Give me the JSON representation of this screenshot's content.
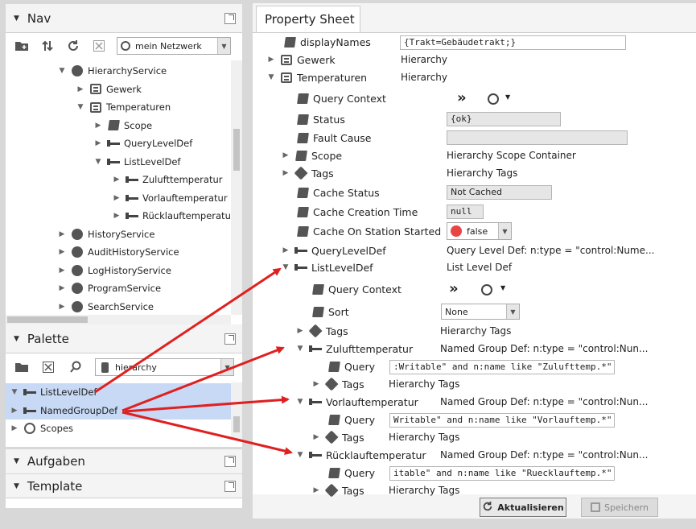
{
  "nav": {
    "title": "Nav",
    "network_label": "mein Netzwerk",
    "tree": [
      {
        "label": "HierarchyService",
        "icon": "hierarchy-service-icon",
        "toggle": "▼"
      },
      {
        "label": "Gewerk",
        "icon": "hierarchy-icon",
        "toggle": "▶"
      },
      {
        "label": "Temperaturen",
        "icon": "hierarchy-icon",
        "toggle": "▼"
      },
      {
        "label": "Scope",
        "icon": "scope-icon",
        "toggle": "▶"
      },
      {
        "label": "QueryLevelDef",
        "icon": "level-def-icon",
        "toggle": "▶"
      },
      {
        "label": "ListLevelDef",
        "icon": "level-def-icon",
        "toggle": "▼"
      },
      {
        "label": "Zulufttemperatur",
        "icon": "level-def-icon",
        "toggle": "▶"
      },
      {
        "label": "Vorlauftemperatur",
        "icon": "level-def-icon",
        "toggle": "▶"
      },
      {
        "label": "Rücklauftemperatur",
        "icon": "level-def-icon",
        "toggle": "▶"
      },
      {
        "label": "HistoryService",
        "icon": "history-service-icon",
        "toggle": "▶"
      },
      {
        "label": "AuditHistoryService",
        "icon": "audit-history-icon",
        "toggle": "▶"
      },
      {
        "label": "LogHistoryService",
        "icon": "log-history-icon",
        "toggle": "▶"
      },
      {
        "label": "ProgramService",
        "icon": "program-service-icon",
        "toggle": "▶"
      },
      {
        "label": "SearchService",
        "icon": "search-service-icon",
        "toggle": "▶"
      }
    ]
  },
  "palette": {
    "title": "Palette",
    "search_value": "hierarchy",
    "items": [
      {
        "label": "ListLevelDef",
        "toggle": "▼"
      },
      {
        "label": "NamedGroupDef",
        "toggle": "▶"
      },
      {
        "label": "Scopes",
        "toggle": "▶"
      }
    ]
  },
  "aufgaben": {
    "title": "Aufgaben"
  },
  "template": {
    "title": "Template"
  },
  "sheet": {
    "tab": "Property Sheet",
    "rows": [
      {
        "name": "displayNames",
        "value": "{Trakt=Gebäudetrakt;}"
      },
      {
        "name": "Gewerk",
        "value": "Hierarchy"
      },
      {
        "name": "Temperaturen",
        "value": "Hierarchy"
      },
      {
        "name": "Query Context",
        "value": ""
      },
      {
        "name": "Status",
        "value": "{ok}"
      },
      {
        "name": "Fault Cause",
        "value": ""
      },
      {
        "name": "Scope",
        "value": "Hierarchy Scope Container"
      },
      {
        "name": "Tags",
        "value": "Hierarchy Tags"
      },
      {
        "name": "Cache Status",
        "value": "Not Cached"
      },
      {
        "name": "Cache Creation Time",
        "value": "null"
      },
      {
        "name": "Cache On Station Started",
        "value": "false"
      },
      {
        "name": "QueryLevelDef",
        "value": "Query Level Def: n:type = \"control:Nume..."
      },
      {
        "name": "ListLevelDef",
        "value": "List Level Def"
      },
      {
        "name": "Query Context",
        "value": ""
      },
      {
        "name": "Sort",
        "value": "None"
      },
      {
        "name": "Tags",
        "value": "Hierarchy Tags"
      },
      {
        "name": "Zulufttemperatur",
        "value": "Named Group Def: n:type = \"control:Nun..."
      },
      {
        "name": "Query",
        "value": ":Writable\" and n:name like \"Zulufttemp.*\""
      },
      {
        "name": "Tags",
        "value": "Hierarchy Tags"
      },
      {
        "name": "Vorlauftemperatur",
        "value": "Named Group Def: n:type = \"control:Nun..."
      },
      {
        "name": "Query",
        "value": "Writable\" and n:name like \"Vorlauftemp.*\""
      },
      {
        "name": "Tags",
        "value": "Hierarchy Tags"
      },
      {
        "name": "Rücklauftemperatur",
        "value": "Named Group Def: n:type = \"control:Nun..."
      },
      {
        "name": "Query",
        "value": "itable\" and n:name like \"Ruecklauftemp.*\""
      },
      {
        "name": "Tags",
        "value": "Hierarchy Tags"
      }
    ],
    "refresh_label": "Aktualisieren",
    "save_label": "Speichern"
  },
  "colors": {
    "annotation_arrow": "#e02020",
    "selection": "#c7d9f5",
    "false_dot": "#e84545"
  }
}
